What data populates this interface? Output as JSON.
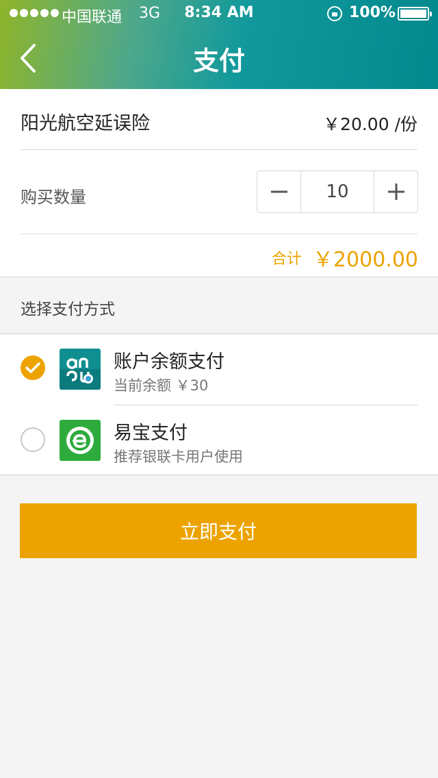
{
  "status_bar": {
    "carrier": "中国联通",
    "network": "3G",
    "time": "8:34 AM",
    "battery": "100%"
  },
  "nav": {
    "title": "支付"
  },
  "product": {
    "name": "阳光航空延误险",
    "unit_price": "￥20.00 /份",
    "quantity_label": "购买数量",
    "quantity": "10",
    "total_label": "合计",
    "total_value": "￥2000.00"
  },
  "payment": {
    "section_title": "选择支付方式",
    "options": [
      {
        "name": "账户余额支付",
        "subtitle": "当前余额  ￥30",
        "selected": true,
        "icon": "account-balance-logo-icon"
      },
      {
        "name": "易宝支付",
        "subtitle": "推荐银联卡用户使用",
        "selected": false,
        "icon": "yeepay-logo-icon"
      }
    ]
  },
  "actions": {
    "pay_now": "立即支付"
  },
  "colors": {
    "accent": "#eca300",
    "header_teal": "#03898d",
    "header_green": "#8fb52a"
  }
}
